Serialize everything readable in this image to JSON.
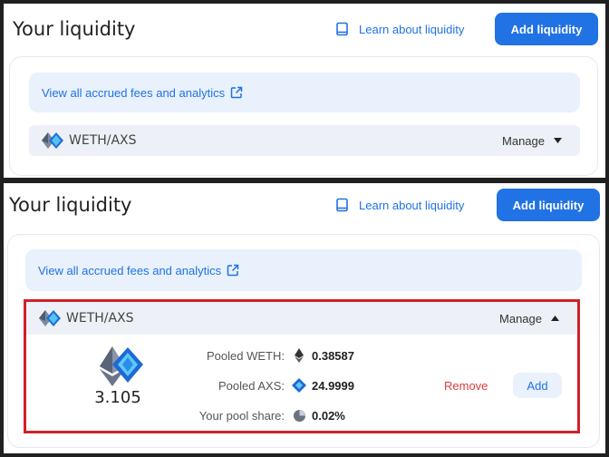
{
  "colors": {
    "accent": "#2172e5",
    "danger": "#e03a3e",
    "highlight": "#d0202a"
  },
  "top": {
    "title": "Your liquidity",
    "learn_label": "Learn about liquidity",
    "add_label": "Add liquidity",
    "fees_label": "View all accrued fees and analytics",
    "pair": "WETH/AXS",
    "manage_label": "Manage"
  },
  "bottom": {
    "title": "Your liquidity",
    "learn_label": "Learn about liquidity",
    "add_label": "Add liquidity",
    "fees_label": "View all accrued fees and analytics",
    "pair": "WETH/AXS",
    "manage_label": "Manage",
    "lp_amount": "3.105",
    "stats": [
      {
        "label": "Pooled WETH:",
        "value": "0.38587",
        "icon": "eth-icon"
      },
      {
        "label": "Pooled AXS:",
        "value": "24.9999",
        "icon": "axs-icon"
      },
      {
        "label": "Your pool share:",
        "value": "0.02%",
        "icon": "pie-chart-icon"
      }
    ],
    "remove_label": "Remove",
    "add_small_label": "Add"
  }
}
